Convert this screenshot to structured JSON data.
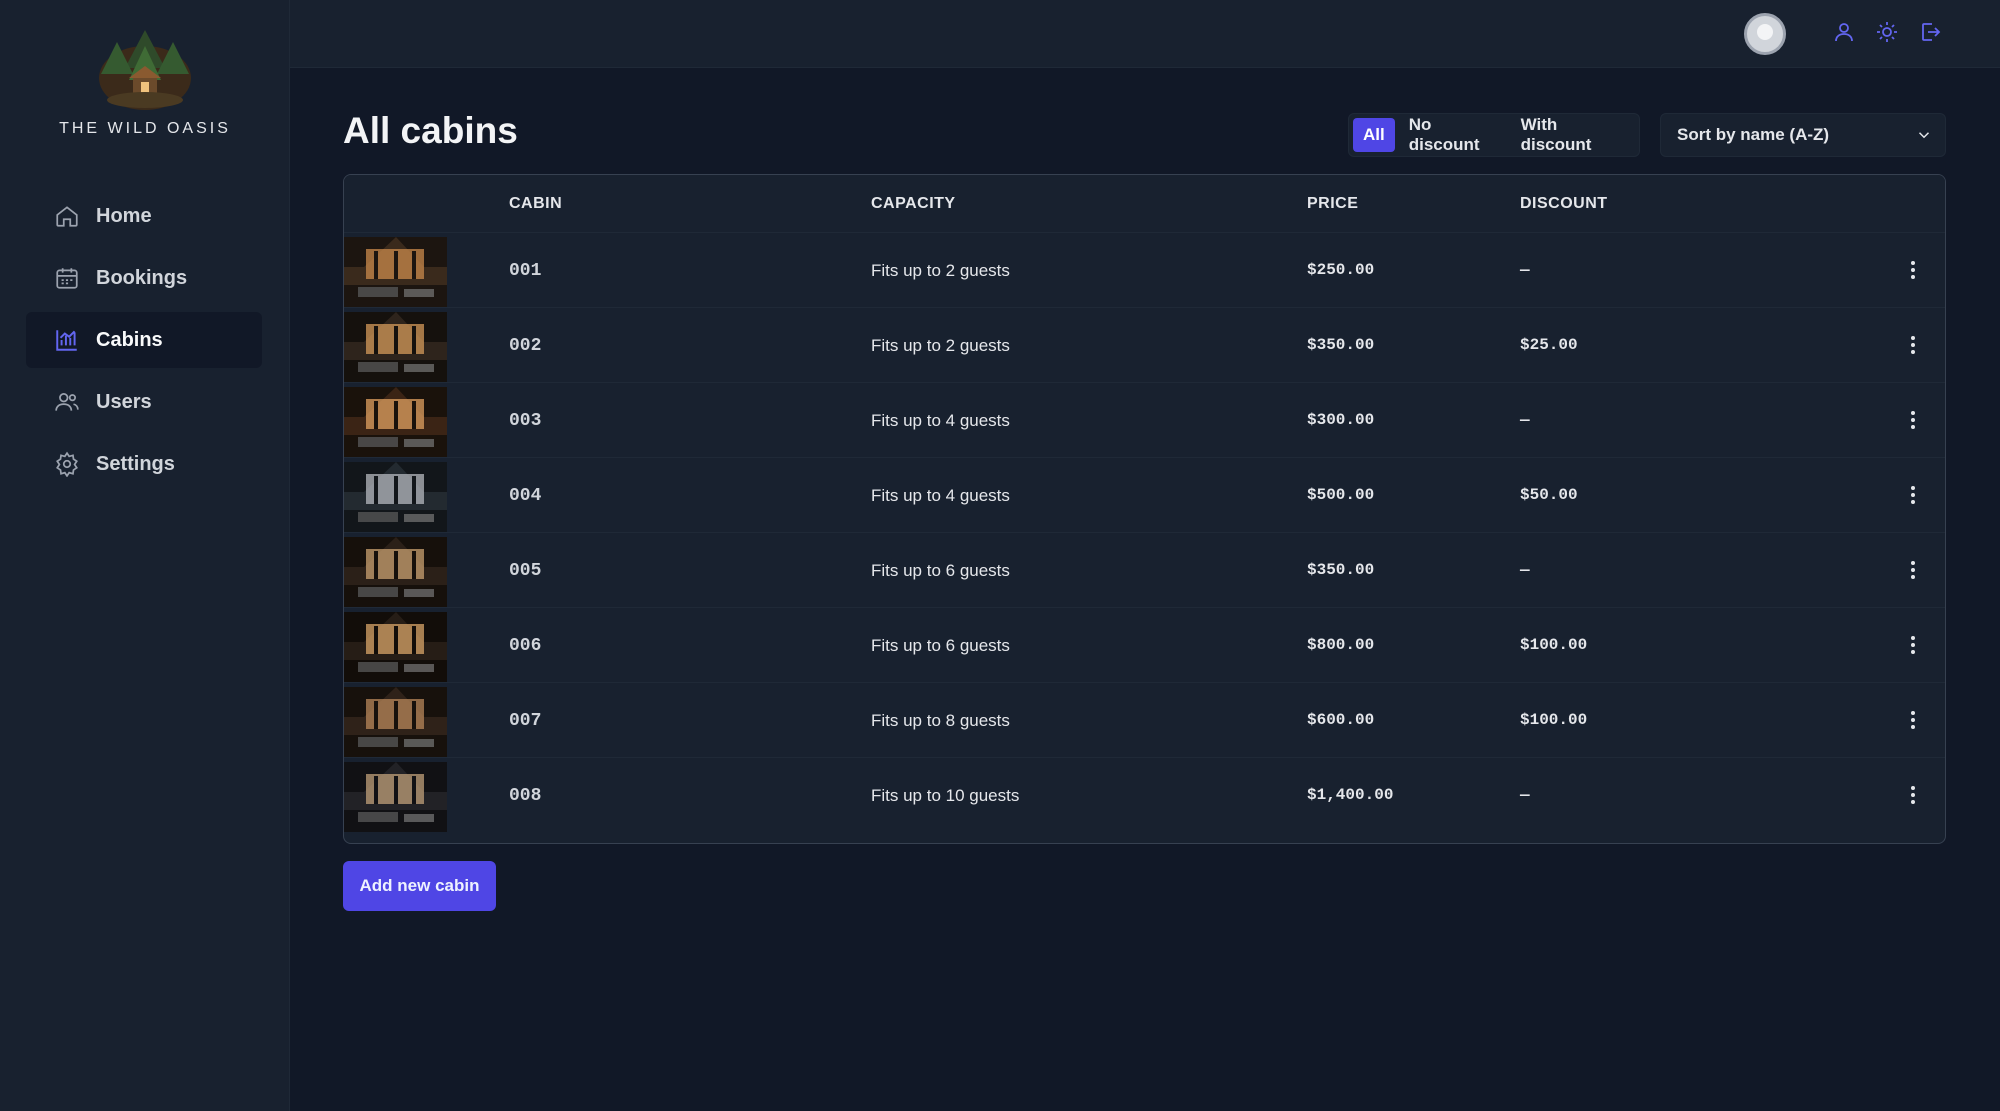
{
  "app": {
    "brand": "THE WILD OASIS"
  },
  "sidebar": {
    "items": [
      {
        "label": "Home",
        "icon": "home-icon",
        "active": false
      },
      {
        "label": "Bookings",
        "icon": "calendar-icon",
        "active": false
      },
      {
        "label": "Cabins",
        "icon": "chart-icon",
        "active": true
      },
      {
        "label": "Users",
        "icon": "users-icon",
        "active": false
      },
      {
        "label": "Settings",
        "icon": "gear-icon",
        "active": false
      }
    ]
  },
  "header": {
    "icons": [
      "user-icon",
      "sun-icon",
      "logout-icon"
    ]
  },
  "main": {
    "title": "All cabins",
    "filter": {
      "options": [
        "All",
        "No discount",
        "With discount"
      ],
      "selected": "All"
    },
    "sort": {
      "selected": "Sort by name (A-Z)"
    },
    "table": {
      "headers": [
        "CABIN",
        "CAPACITY",
        "PRICE",
        "DISCOUNT"
      ],
      "rows": [
        {
          "name": "001",
          "capacity": "Fits up to 2 guests",
          "price": "$250.00",
          "discount": "—"
        },
        {
          "name": "002",
          "capacity": "Fits up to 2 guests",
          "price": "$350.00",
          "discount": "$25.00"
        },
        {
          "name": "003",
          "capacity": "Fits up to 4 guests",
          "price": "$300.00",
          "discount": "—"
        },
        {
          "name": "004",
          "capacity": "Fits up to 4 guests",
          "price": "$500.00",
          "discount": "$50.00"
        },
        {
          "name": "005",
          "capacity": "Fits up to 6 guests",
          "price": "$350.00",
          "discount": "—"
        },
        {
          "name": "006",
          "capacity": "Fits up to 6 guests",
          "price": "$800.00",
          "discount": "$100.00"
        },
        {
          "name": "007",
          "capacity": "Fits up to 8 guests",
          "price": "$600.00",
          "discount": "$100.00"
        },
        {
          "name": "008",
          "capacity": "Fits up to 10 guests",
          "price": "$1,400.00",
          "discount": "—"
        }
      ]
    },
    "add_button": "Add new cabin"
  },
  "colors": {
    "accent": "#4f46e5",
    "background": "#111827",
    "surface": "#18212f"
  }
}
